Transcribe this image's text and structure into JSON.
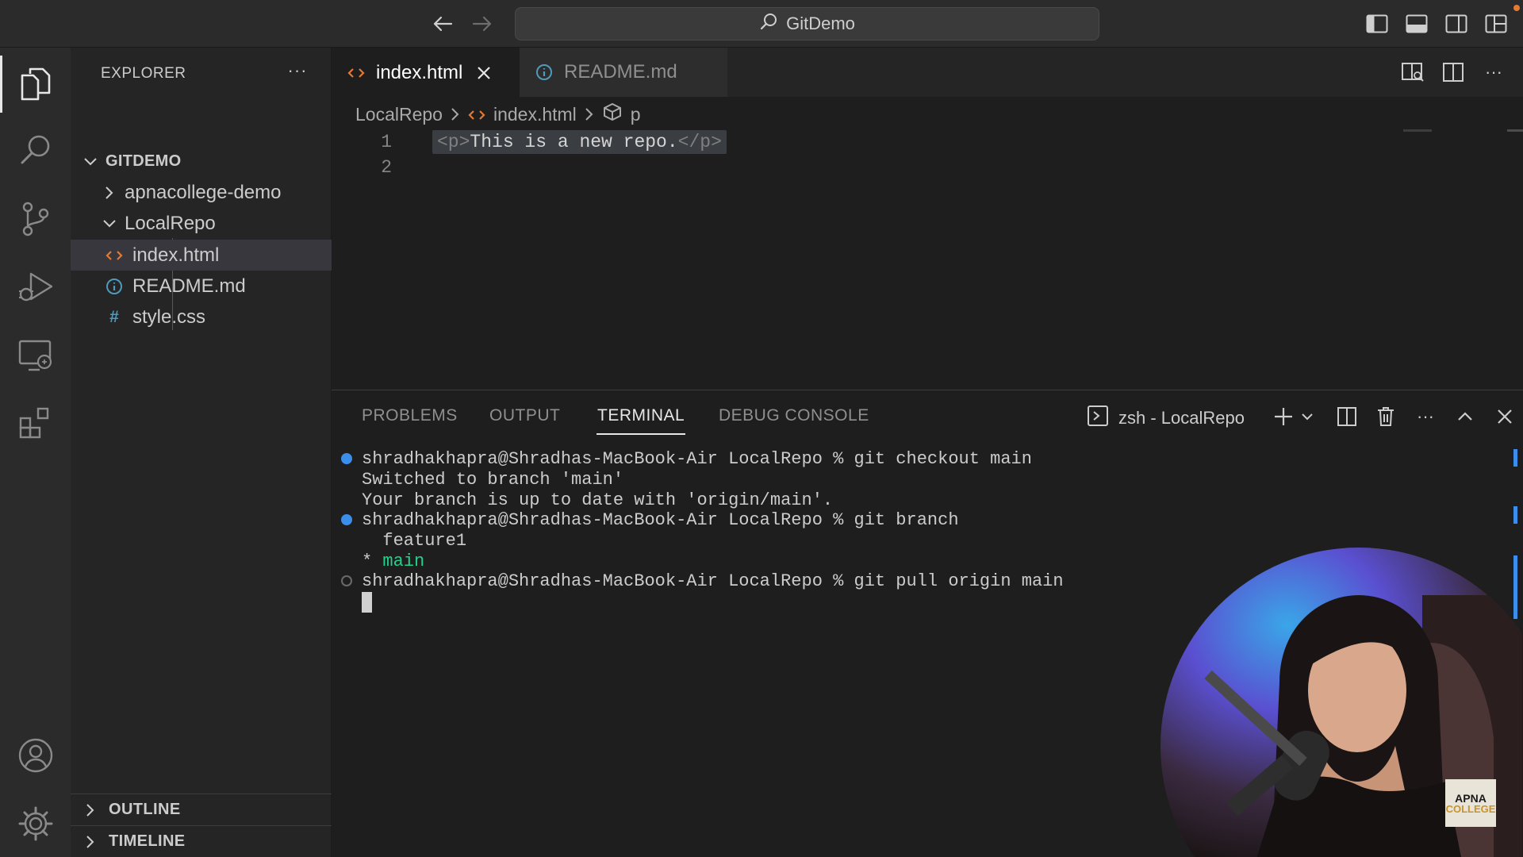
{
  "window": {
    "title": "GitDemo"
  },
  "sidebar": {
    "title": "EXPLORER",
    "root": "GITDEMO",
    "items": [
      {
        "label": "apnacollege-demo",
        "type": "folder",
        "expanded": false
      },
      {
        "label": "LocalRepo",
        "type": "folder",
        "expanded": true
      },
      {
        "label": "index.html",
        "type": "file",
        "icon": "html-icon",
        "selected": true
      },
      {
        "label": "README.md",
        "type": "file",
        "icon": "info-icon"
      },
      {
        "label": "style.css",
        "type": "file",
        "icon": "css-icon"
      }
    ],
    "css_glyph": "#",
    "sections": [
      "OUTLINE",
      "TIMELINE"
    ]
  },
  "editor": {
    "tabs": [
      {
        "label": "index.html",
        "active": true
      },
      {
        "label": "README.md",
        "active": false
      }
    ],
    "breadcrumbs": [
      "LocalRepo",
      "index.html",
      "p"
    ],
    "lines": [
      {
        "number": "1",
        "open_tag": "<p>",
        "text": "This is a new repo.",
        "close_tag": "</p>"
      },
      {
        "number": "2"
      }
    ]
  },
  "panel": {
    "tabs": [
      "PROBLEMS",
      "OUTPUT",
      "TERMINAL",
      "DEBUG CONSOLE"
    ],
    "active_tab": "TERMINAL",
    "terminal_name": "zsh - LocalRepo",
    "terminal_lines": [
      "shradhakhapra@Shradhas-MacBook-Air LocalRepo % git checkout main",
      "Switched to branch 'main'",
      "Your branch is up to date with 'origin/main'.",
      "shradhakhapra@Shradhas-MacBook-Air LocalRepo % git branch",
      "  feature1",
      "* ",
      "main",
      "shradhakhapra@Shradhas-MacBook-Air LocalRepo % git pull origin main"
    ]
  },
  "overlay": {
    "logo_line1": "APNA",
    "logo_line2": "COLLEGE"
  },
  "colors": {
    "accent": "#3b8eea",
    "html_icon": "#e37933",
    "info_icon": "#519aba",
    "css_icon": "#519aba",
    "branch_current": "#23d18b"
  }
}
